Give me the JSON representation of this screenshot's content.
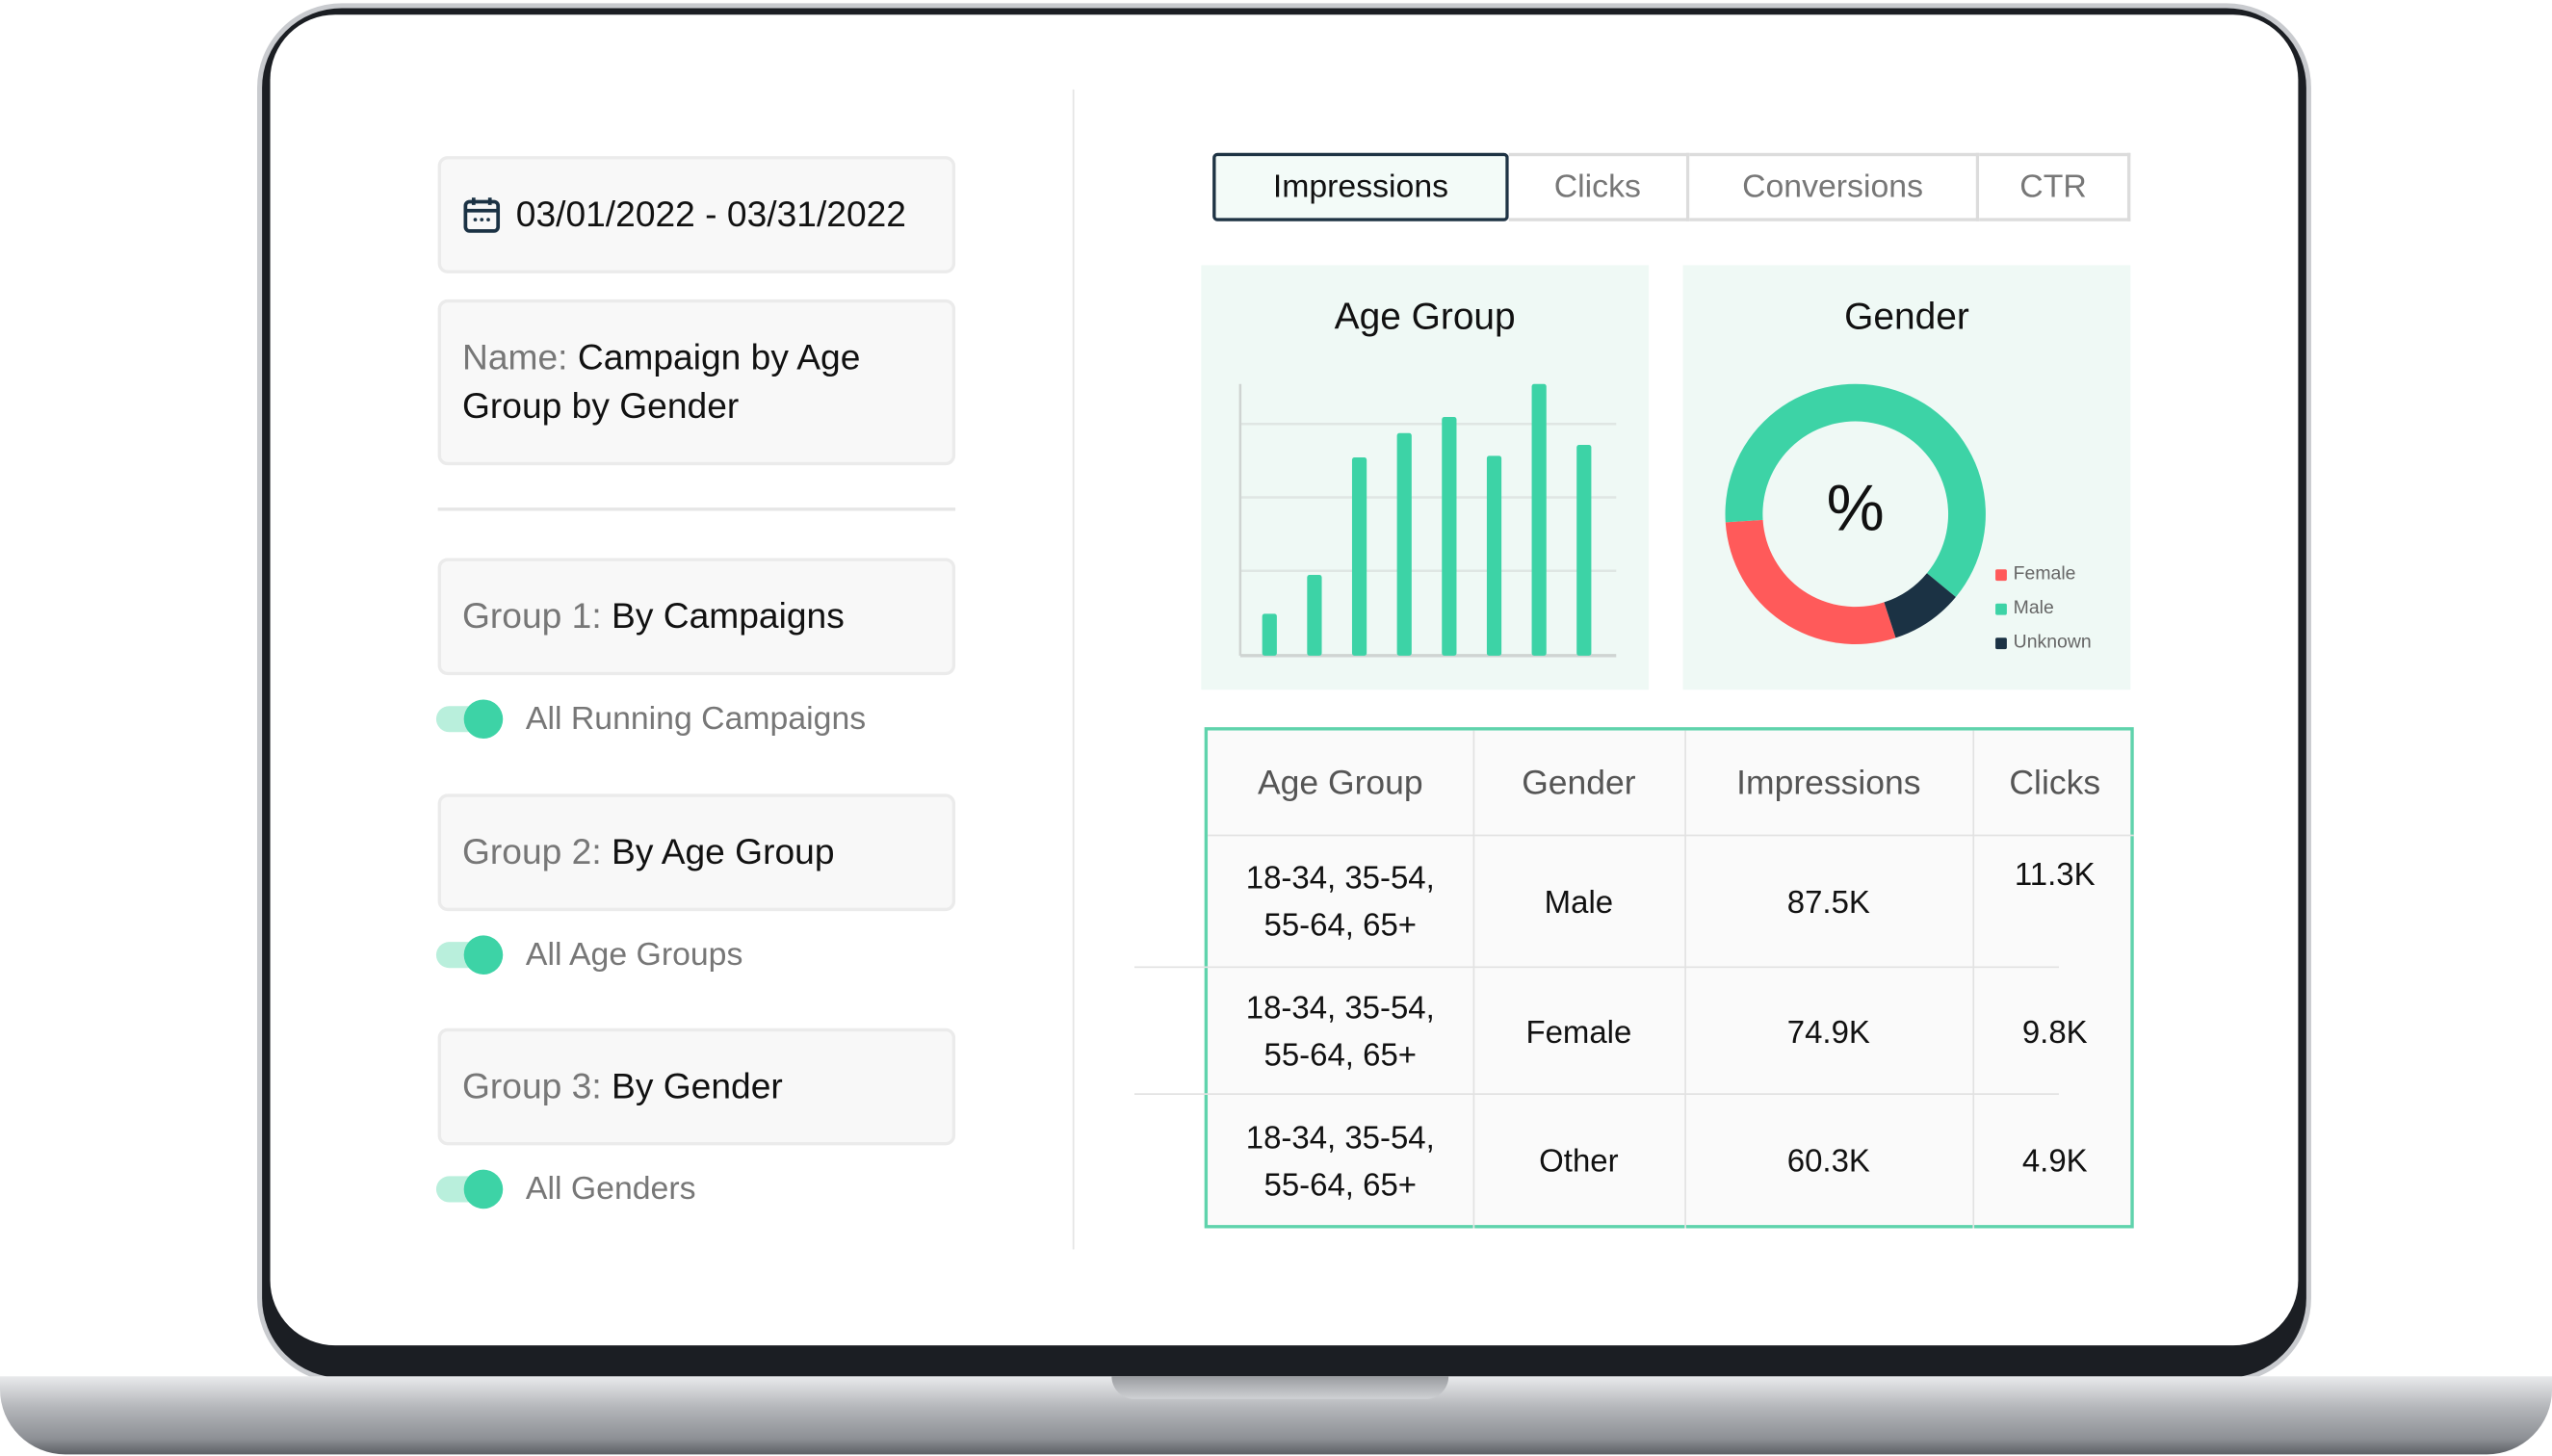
{
  "date_range": {
    "icon": "calendar-icon",
    "value": "03/01/2022 - 03/31/2022"
  },
  "report_name": {
    "label": "Name:",
    "value": "Campaign by Age Group by Gender"
  },
  "groups": [
    {
      "label": "Group 1:",
      "value": "By Campaigns",
      "toggle_label": "All Running Campaigns",
      "toggle_on": true
    },
    {
      "label": "Group 2:",
      "value": "By Age Group",
      "toggle_label": "All Age Groups",
      "toggle_on": true
    },
    {
      "label": "Group 3:",
      "value": "By Gender",
      "toggle_label": "All Genders",
      "toggle_on": true
    }
  ],
  "tabs": [
    {
      "label": "Impressions",
      "active": true
    },
    {
      "label": "Clicks",
      "active": false
    },
    {
      "label": "Conversions",
      "active": false
    },
    {
      "label": "CTR",
      "active": false
    }
  ],
  "colors": {
    "accent": "#3dd3a6",
    "female": "#ff5a5a",
    "male": "#3dd3a6",
    "unknown": "#1b3244",
    "card_bg": "#eff9f5",
    "table_border": "#5fd3ac"
  },
  "chart_data": [
    {
      "type": "bar",
      "title": "Age Group",
      "values": [
        0.57,
        1.1,
        2.7,
        3.03,
        3.25,
        2.72,
        3.7,
        2.87
      ],
      "ylim": [
        0,
        3.7
      ],
      "grid": true,
      "color": "#3dd3a6"
    },
    {
      "type": "pie",
      "title": "Gender",
      "center_label": "%",
      "donut": true,
      "series": [
        {
          "name": "Female",
          "value": 29,
          "color": "#ff5a5a"
        },
        {
          "name": "Male",
          "value": 62,
          "color": "#3dd3a6"
        },
        {
          "name": "Unknown",
          "value": 9,
          "color": "#1b3244"
        }
      ],
      "legend": "bottom-right"
    }
  ],
  "table": {
    "columns": [
      "Age Group",
      "Gender",
      "Impressions",
      "Clicks"
    ],
    "rows": [
      [
        "18-34, 35-54, 55-64, 65+",
        "Male",
        "87.5K",
        "11.3K"
      ],
      [
        "18-34, 35-54, 55-64, 65+",
        "Female",
        "74.9K",
        "9.8K"
      ],
      [
        "18-34, 35-54, 55-64, 65+",
        "Other",
        "60.3K",
        "4.9K"
      ]
    ]
  }
}
